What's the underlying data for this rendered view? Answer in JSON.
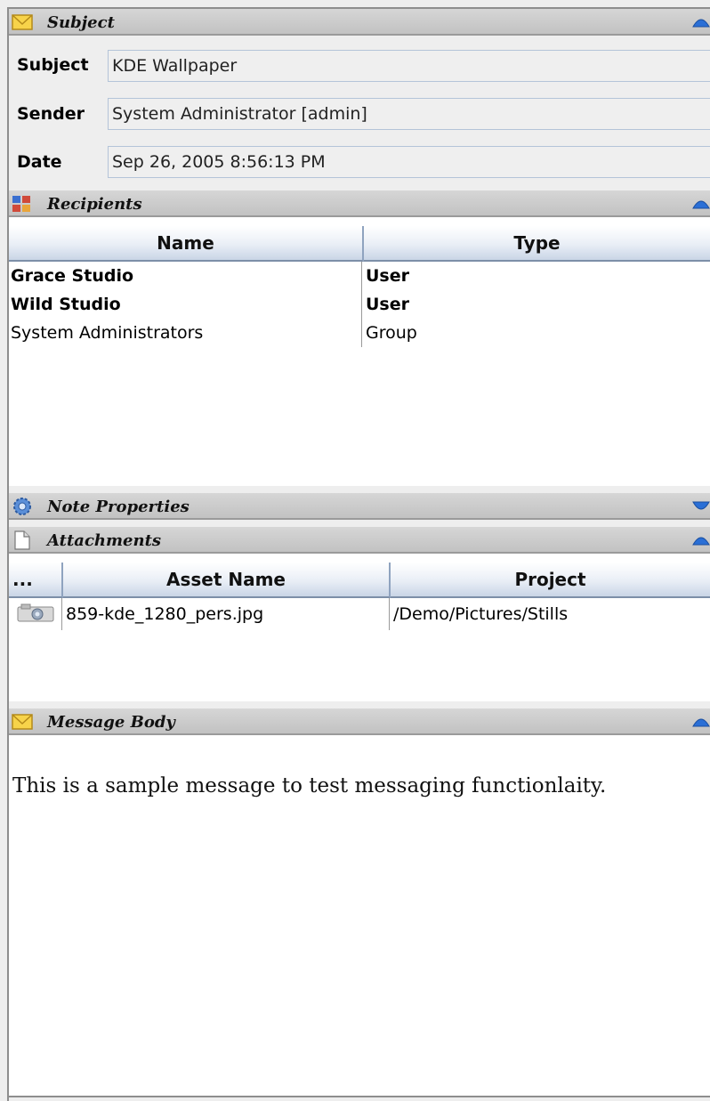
{
  "subject_section": {
    "title": "Subject",
    "fields": [
      {
        "label": "Subject",
        "value": "KDE Wallpaper"
      },
      {
        "label": "Sender",
        "value": "System Administrator [admin]"
      },
      {
        "label": "Date",
        "value": "Sep 26, 2005 8:56:13 PM"
      }
    ]
  },
  "recipients_section": {
    "title": "Recipients",
    "columns": [
      "Name",
      "Type"
    ],
    "rows": [
      {
        "name": "Grace Studio",
        "type": "User"
      },
      {
        "name": "Wild Studio",
        "type": "User"
      },
      {
        "name": "System Administrators",
        "type": "Group"
      }
    ]
  },
  "note_properties_section": {
    "title": "Note Properties"
  },
  "attachments_section": {
    "title": "Attachments",
    "columns": [
      "...",
      "Asset Name",
      "Project"
    ],
    "rows": [
      {
        "asset_name": "859-kde_1280_pers.jpg",
        "project": "/Demo/Pictures/Stills",
        "icon": "camera-icon"
      }
    ]
  },
  "message_body_section": {
    "title": "Message Body",
    "text": "This is a sample message to test messaging functionlaity."
  },
  "colors": {
    "header_bg": "#c8c8c8",
    "table_header_border": "#8fa3bf",
    "toggle_blue": "#2a6fd6",
    "field_border": "#b4c4d8"
  }
}
